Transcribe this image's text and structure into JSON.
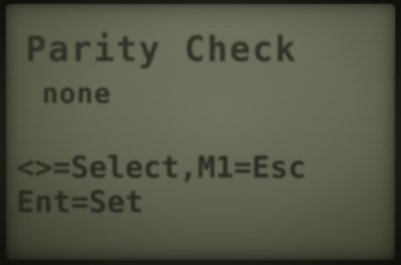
{
  "screen": {
    "title": "Parity Check",
    "value": "none",
    "hint_line_1": "<>=Select,M1=Esc",
    "hint_line_2": "Ent=Set"
  },
  "colors": {
    "lcd_background": "#666b57",
    "lcd_text": "#262a1f"
  }
}
